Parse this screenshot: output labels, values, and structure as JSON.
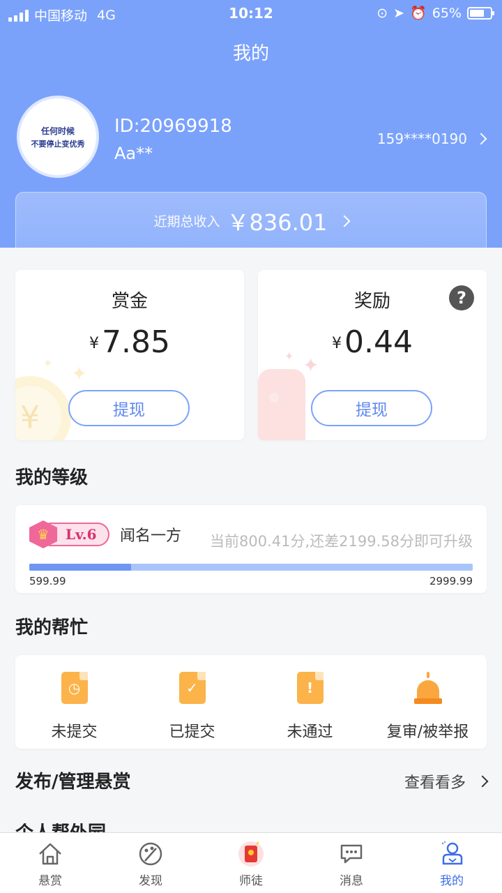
{
  "status_bar": {
    "carrier": "中国移动",
    "network": "4G",
    "time": "10:12",
    "battery": "65%"
  },
  "header": {
    "title": "我的"
  },
  "profile": {
    "avatar_lines": [
      "任何时候",
      "不要停止变优秀"
    ],
    "user_id": "ID:20969918",
    "username": "Aa**",
    "phone": "159****0190"
  },
  "income": {
    "label": "近期总收入",
    "amount": "￥836.01"
  },
  "bounty": {
    "title": "赏金",
    "currency": "¥",
    "amount": "7.85",
    "withdraw_label": "提现"
  },
  "reward": {
    "title": "奖励",
    "currency": "¥",
    "amount": "0.44",
    "withdraw_label": "提现",
    "help_symbol": "?"
  },
  "level": {
    "section_title": "我的等级",
    "badge": "Lv.6",
    "name": "闻名一方",
    "description": "当前800.41分,还差2199.58分即可升级",
    "min": "599.99",
    "max": "2999.99",
    "progress_fraction": 0.23
  },
  "my_help": {
    "section_title": "我的帮忙",
    "items": [
      {
        "label": "未提交",
        "icon": "clock-document-icon"
      },
      {
        "label": "已提交",
        "icon": "check-document-icon"
      },
      {
        "label": "未通过",
        "icon": "exclamation-document-icon"
      },
      {
        "label": "复审/被举报",
        "icon": "alarm-light-icon"
      }
    ]
  },
  "publish": {
    "section_title": "发布/管理悬赏",
    "more_label": "查看看多"
  },
  "partial_section": {
    "title": "个人帮外园"
  },
  "tabbar": {
    "tabs": [
      {
        "label": "悬赏",
        "icon": "home-icon"
      },
      {
        "label": "发现",
        "icon": "palette-icon"
      },
      {
        "label": "师徒",
        "icon": "red-envelope-icon"
      },
      {
        "label": "消息",
        "icon": "chat-icon"
      },
      {
        "label": "我的",
        "icon": "user-icon"
      }
    ],
    "active_index": 4
  },
  "colors": {
    "header_blue": "#7aa2fb",
    "accent_blue": "#5f89f0",
    "active_tab": "#3d6ee8",
    "orange_icon": "#fbb34a",
    "level_pink": "#f0679a"
  }
}
